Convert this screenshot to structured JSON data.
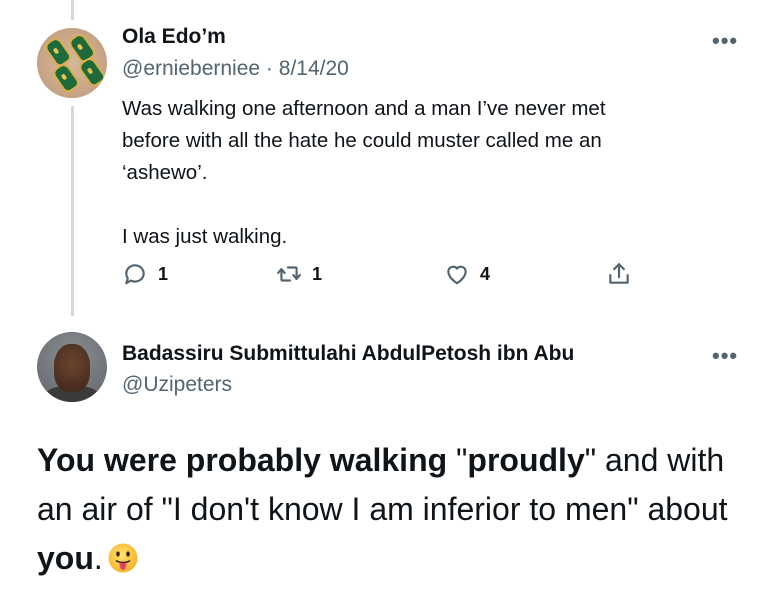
{
  "tweet": {
    "author_name": "Ola Edo’m",
    "handle": "@ernieberniee",
    "separator": "·",
    "date": "8/14/20",
    "more": "•••",
    "text_lines": [
      "Was walking one afternoon and a man I’ve never met",
      "before with all the hate he could muster called me an",
      "‘ashewo’."
    ],
    "text_last": "I was just walking.",
    "actions": {
      "reply_count": "1",
      "retweet_count": "1",
      "like_count": "4"
    }
  },
  "reply": {
    "author_name": "Badassiru Submittulahi AbdulPetosh ibn Abu",
    "handle": "@Uzipeters",
    "more": "•••",
    "segments": [
      {
        "text": "You were probably walking",
        "bold": true
      },
      {
        "text": " \"",
        "bold": false
      },
      {
        "text": "proudly",
        "bold": true
      },
      {
        "text": "\" and with an air of \"I don't know I am inferior to men\" about ",
        "bold": false
      },
      {
        "text": "you",
        "bold": true
      },
      {
        "text": ".",
        "bold": false
      }
    ],
    "emoji": "tongue-out-face-emoji"
  },
  "colors": {
    "text": "#0f1419",
    "secondary": "#536471",
    "thread_line": "#cfd9de"
  }
}
